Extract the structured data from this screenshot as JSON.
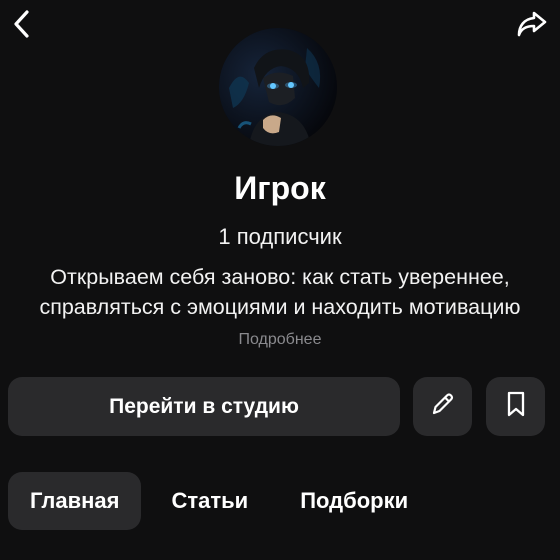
{
  "header": {
    "back_icon": "chevron-left-icon",
    "share_icon": "share-arrow-icon"
  },
  "channel": {
    "name": "Игрок",
    "subscribers": "1 подписчик",
    "description": "Открываем себя заново: как стать увереннее, справляться с эмоциями и находить мотивацию",
    "more_label": "Подробнее"
  },
  "actions": {
    "studio_label": "Перейти в студию",
    "edit_icon": "pencil-icon",
    "bookmark_icon": "bookmark-icon"
  },
  "tabs": [
    {
      "label": "Главная",
      "active": true
    },
    {
      "label": "Статьи",
      "active": false
    },
    {
      "label": "Подборки",
      "active": false
    }
  ],
  "colors": {
    "background": "#0f0f10",
    "button_bg": "#2a2a2c",
    "muted_text": "#8a8a8e",
    "avatar_glow": "#4fb8ff"
  }
}
